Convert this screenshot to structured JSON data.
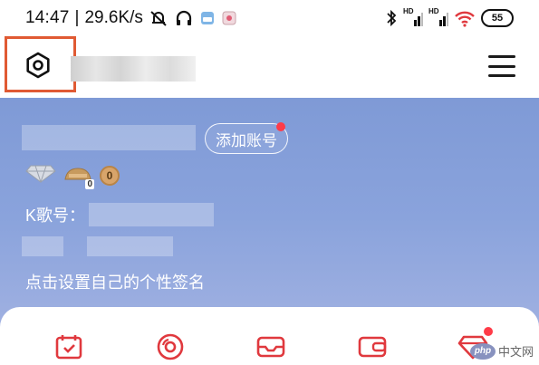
{
  "status_bar": {
    "time": "14:47",
    "separator": "|",
    "speed": "29.6K/s",
    "signal_label_1": "HD",
    "signal_label_2": "HD",
    "battery": "55"
  },
  "app_bar": {
    "settings_icon": "settings-hexagon-icon",
    "menu_icon": "hamburger-menu-icon"
  },
  "profile": {
    "add_account_label": "添加账号",
    "vip_badge_count": "0",
    "coin_count": "0",
    "k_number_label": "K歌号：",
    "signature_prompt": "点击设置自己的个性签名"
  },
  "quick_actions": [
    {
      "icon": "calendar-check-icon"
    },
    {
      "icon": "disc-icon"
    },
    {
      "icon": "inbox-icon"
    },
    {
      "icon": "wallet-icon"
    },
    {
      "icon": "gift-diamond-icon"
    }
  ],
  "watermark": {
    "logo": "php",
    "text": "中文网"
  },
  "colors": {
    "accent_red": "#e0393e",
    "highlight_box": "#e05a33",
    "header_blue": "#8aa3dc"
  }
}
